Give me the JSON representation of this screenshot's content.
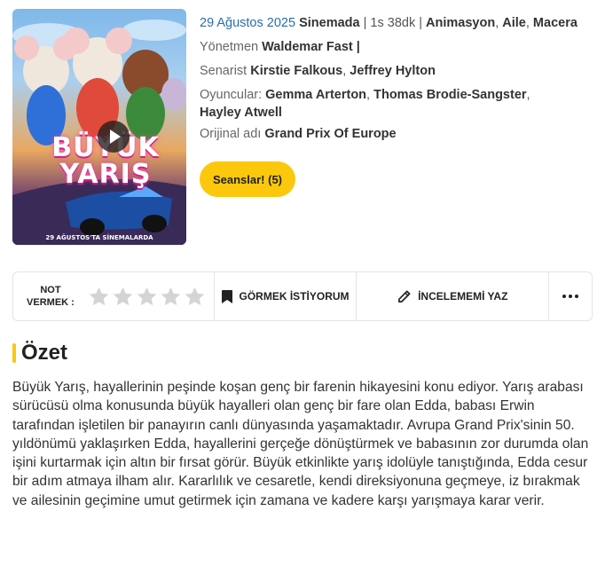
{
  "poster": {
    "title_text": "BÜYÜK YARIŞ",
    "date_text": "29 AĞUSTOS'TA SİNEMALARDA"
  },
  "info": {
    "release_date": "29 Ağustos 2025",
    "venue": "Sinemada",
    "sep1": " | ",
    "duration": "1s 38dk",
    "sep2": " | ",
    "genres": [
      "Animasyon",
      "Aile",
      "Macera"
    ],
    "director_label": "Yönetmen",
    "director": "Waldemar Fast",
    "director_trailing": " |",
    "writer_label": "Senarist",
    "writers": [
      "Kirstie Falkous",
      "Jeffrey Hylton"
    ],
    "cast_label": "Oyuncular:",
    "cast": [
      "Gemma Arterton",
      "Thomas Brodie-Sangster",
      "Hayley Atwell"
    ],
    "original_label": "Orijinal adı",
    "original_title": "Grand Prix Of Europe"
  },
  "seans_button": "Seanslar! (5)",
  "action_bar": {
    "rate_label_1": "NOT",
    "rate_label_2": "VERMEK :",
    "rating_value": 0,
    "rating_max": 5,
    "watch_label": "GÖRMEK İSTİYORUM",
    "review_label": "İNCELEMEMİ YAZ"
  },
  "summary": {
    "heading": "Özet",
    "text": "Büyük Yarış, hayallerinin peşinde koşan genç bir farenin hikayesini konu ediyor. Yarış arabası sürücüsü olma konusunda büyük hayalleri olan genç bir fare olan Edda, babası Erwin tarafından işletilen bir panayırın canlı dünyasında yaşamaktadır. Avrupa Grand Prix'sinin 50. yıldönümü yaklaşırken Edda, hayallerini gerçeğe dönüştürmek ve babasının zor durumda olan işini kurtarmak için altın bir fırsat görür. Büyük etkinlikte yarış idolüyle tanıştığında, Edda cesur bir adım atmaya ilham alır. Kararlılık ve cesaretle, kendi direksiyonuna geçmeye, iz bırakmak ve ailesinin geçimine umut getirmek için zamana ve kadere karşı yarışmaya karar verir."
  },
  "colors": {
    "accent": "#fcc80d",
    "date_link": "#2b6cb0",
    "star_empty": "#d4d4d4"
  },
  "icons": [
    "play-icon",
    "bookmark-icon",
    "pencil-icon",
    "more-dots-icon",
    "star-icon"
  ]
}
